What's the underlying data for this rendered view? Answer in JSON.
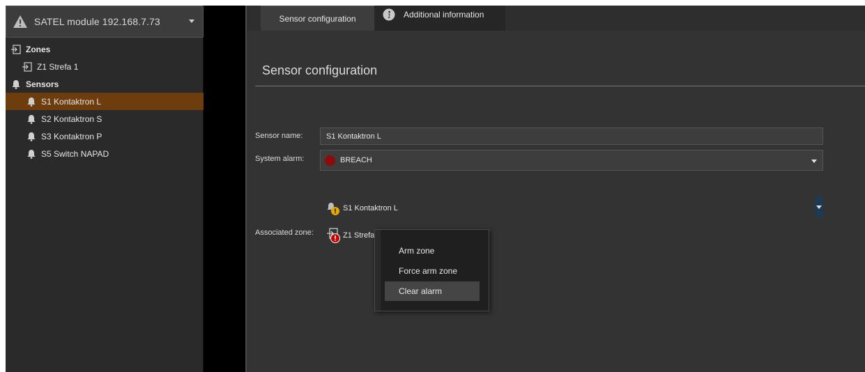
{
  "device": {
    "title": "SATEL module 192.168.7.73"
  },
  "tree": {
    "zones_header": "Zones",
    "zones": [
      {
        "label": "Z1 Strefa 1"
      }
    ],
    "sensors_header": "Sensors",
    "sensors": [
      {
        "label": "S1 Kontaktron L",
        "selected": true
      },
      {
        "label": "S2 Kontaktron S"
      },
      {
        "label": "S3 Kontaktron P"
      },
      {
        "label": "S5 Switch NAPAD"
      }
    ]
  },
  "tabs": [
    {
      "label": "Sensor configuration",
      "active": true
    },
    {
      "label": "Additional information"
    }
  ],
  "section_title": "Sensor configuration",
  "form": {
    "sensor_name_label": "Sensor name:",
    "sensor_name_value": "S1 Kontaktron L",
    "system_alarm_label": "System alarm:",
    "system_alarm_value": "BREACH",
    "associated_zone_label": "Associated zone:",
    "associated_sensor": "S1 Kontaktron L",
    "associated_zone": "Z1 Strefa"
  },
  "context_menu": {
    "items": [
      {
        "label": "Arm zone"
      },
      {
        "label": "Force arm zone"
      },
      {
        "label": "Clear alarm",
        "hover": true
      }
    ]
  },
  "colors": {
    "selection": "#6d3d0d",
    "alarm_red": "#8e0b0b",
    "warning_yellow": "#e6a800",
    "error_red": "#c80000"
  }
}
